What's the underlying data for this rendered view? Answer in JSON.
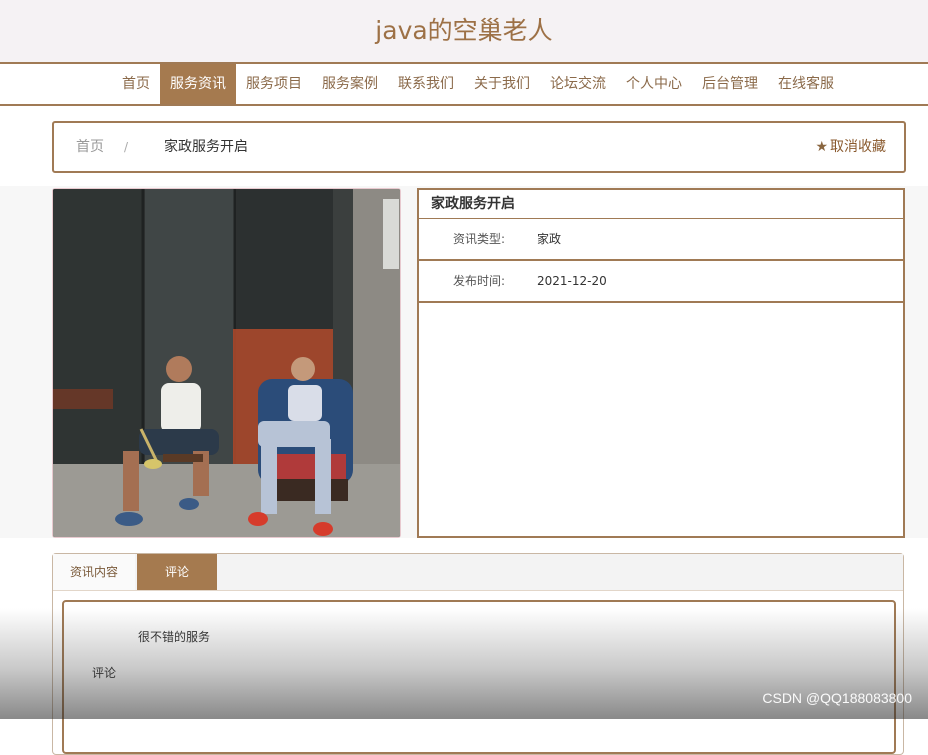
{
  "site": {
    "title": "java的空巢老人"
  },
  "nav": {
    "items": [
      {
        "label": "首页"
      },
      {
        "label": "服务资讯"
      },
      {
        "label": "服务项目"
      },
      {
        "label": "服务案例"
      },
      {
        "label": "联系我们"
      },
      {
        "label": "关于我们"
      },
      {
        "label": "论坛交流"
      },
      {
        "label": "个人中心"
      },
      {
        "label": "后台管理"
      },
      {
        "label": "在线客服"
      }
    ],
    "active_index": 1
  },
  "breadcrumb": {
    "home": "首页",
    "separator": "/",
    "current": "家政服务开启"
  },
  "favorite": {
    "label": "取消收藏",
    "icon": "star-icon"
  },
  "article": {
    "title": "家政服务开启",
    "type_label": "资讯类型:",
    "type_value": "家政",
    "date_label": "发布时间:",
    "date_value": "2021-12-20"
  },
  "tabs": [
    {
      "label": "资讯内容"
    },
    {
      "label": "评论"
    }
  ],
  "comment": {
    "text": "很不错的服务",
    "label": "评论"
  },
  "watermark": "CSDN @QQ188083800",
  "colors": {
    "accent": "#a57a4f",
    "title": "#9d7146"
  }
}
